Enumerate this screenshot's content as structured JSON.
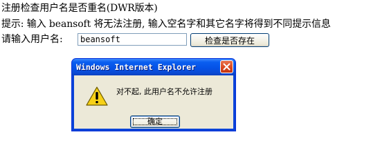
{
  "page": {
    "heading": "注册检查用户名是否重名(DWR版本)",
    "hint": "提示: 输入 beansoft 将无法注册, 输入空名字和其它名字将得到不同提示信息",
    "prompt_label": "请输入用户名:",
    "username_value": "beansoft",
    "check_button_label": "检查是否存在"
  },
  "dialog": {
    "title": "Windows Internet Explorer",
    "message": "对不起, 此用户名不允许注册",
    "ok_label": "确定",
    "icons": {
      "warning": "warning-triangle-icon",
      "close": "close-x-icon"
    }
  },
  "colors": {
    "titlebar": "#0552e6",
    "close_button": "#d9461c",
    "dialog_body": "#ece9d8",
    "warning_yellow": "#f7d117"
  }
}
